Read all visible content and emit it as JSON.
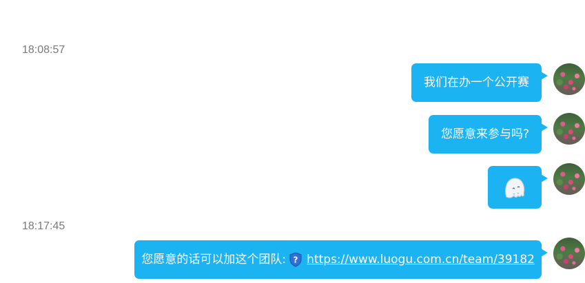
{
  "conversation": {
    "timestamps": [
      "18:08:57",
      "18:17:45"
    ],
    "messages": [
      {
        "text": "我们在办一个公开赛"
      },
      {
        "text": "您愿意来参与吗?"
      },
      {
        "sticker": "ghost-sticker"
      },
      {
        "text": "您愿意的话可以加这个团队:",
        "link": "https://www.luogu.com.cn/team/39182",
        "link_icon": "shield-question-icon"
      }
    ]
  },
  "colors": {
    "bubble": "#1bb3f2",
    "timestamp": "#7a7a7a",
    "background": "#ffffff"
  }
}
